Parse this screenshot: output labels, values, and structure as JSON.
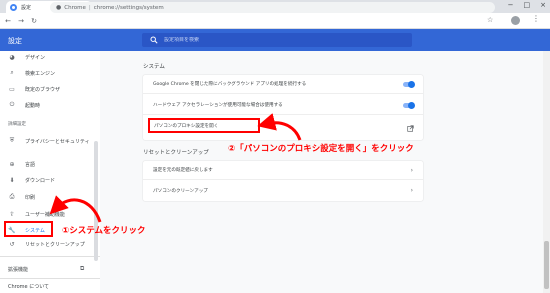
{
  "browser": {
    "tab_title": "設定",
    "tab_close": "×",
    "new_tab": "+",
    "window_controls": [
      "−",
      "□",
      "×"
    ],
    "omnibox_site": "Chrome",
    "omnibox_url": "chrome://settings/system"
  },
  "header": {
    "title": "設定",
    "search_placeholder": "設定項目を検索"
  },
  "sidebar": {
    "items": [
      {
        "label": "デザイン",
        "icon": "palette-icon"
      },
      {
        "label": "検索エンジン",
        "icon": "search-icon"
      },
      {
        "label": "既定のブラウザ",
        "icon": "browser-icon"
      },
      {
        "label": "起動時",
        "icon": "power-icon"
      }
    ],
    "advanced_section": "詳細設定",
    "advanced_items": [
      {
        "label": "プライバシーとセキュリティ",
        "icon": "shield-icon"
      },
      {
        "label": "言語",
        "icon": "globe-icon"
      },
      {
        "label": "ダウンロード",
        "icon": "download-icon"
      },
      {
        "label": "印刷",
        "icon": "print-icon"
      },
      {
        "label": "ユーザー補助機能",
        "icon": "accessibility-icon"
      },
      {
        "label": "システム",
        "icon": "wrench-icon"
      },
      {
        "label": "リセットとクリーンアップ",
        "icon": "reset-icon"
      }
    ],
    "extensions": "拡張機能",
    "about": "Chrome について"
  },
  "main": {
    "system_title": "システム",
    "system_rows": [
      "Google Chrome を閉じた際にバックグラウンド アプリの処理を続行する",
      "ハードウェア アクセラレーションが使用可能な場合は使用する",
      "パソコンのプロキシ設定を開く"
    ],
    "reset_title": "リセットとクリーンアップ",
    "reset_rows": [
      "設定を元の既定値に戻します",
      "パソコンのクリーンアップ"
    ]
  },
  "annotations": {
    "step1": "①システムをクリック",
    "step2": "②「パソコンのプロキシ設定を開く」をクリック",
    "color": "#ff0000"
  }
}
